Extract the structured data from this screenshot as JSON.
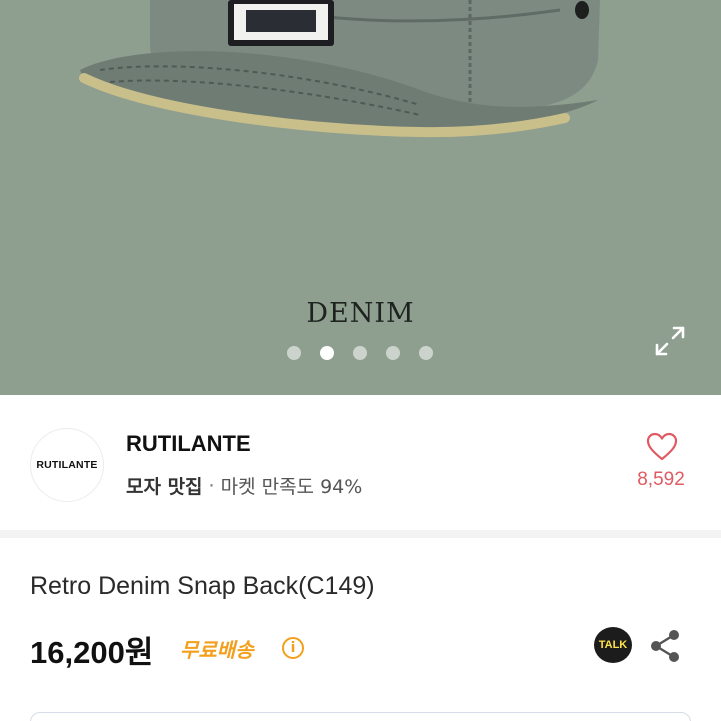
{
  "hero": {
    "caption": "DENIM",
    "carousel": {
      "count": 5,
      "active_index": 1
    },
    "background_color": "#8e9e8f",
    "icons": {
      "expand": "expand-icon"
    }
  },
  "seller": {
    "logo_text": "RUTILANTE",
    "name": "RUTILANTE",
    "category_tag": "모자 맛집",
    "separator": "·",
    "satisfaction": "마켓 만족도 94%",
    "likes": "8,592",
    "icons": {
      "like": "heart-icon"
    }
  },
  "product": {
    "title": "Retro Denim Snap Back(C149)",
    "price": "16,200원",
    "shipping": "무료배송",
    "info_glyph": "i",
    "kakao_label": "TALK",
    "icons": {
      "info": "info-icon",
      "kakao": "kakao-talk-icon",
      "share": "share-icon"
    },
    "colors": {
      "shipping": "#f2a01c",
      "likes": "#e05a62"
    }
  }
}
